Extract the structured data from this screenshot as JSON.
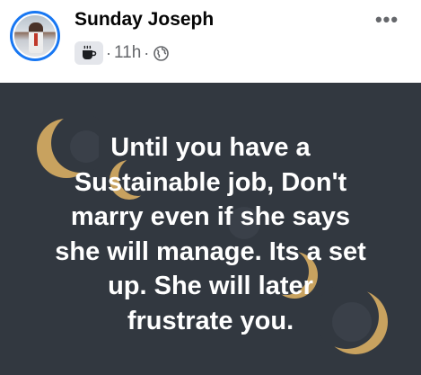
{
  "post": {
    "author": "Sunday Joseph",
    "time": "11h",
    "audience_icon": "globe-icon",
    "activity_icon": "coffee-cup-icon",
    "more_label": "•••",
    "text_lines": [
      "Until you have a",
      "Sustainable job, Don't",
      "marry even if she says",
      "she will manage. Its a set",
      "up. She will later",
      "frustrate you."
    ],
    "background_color": "#323840",
    "text_color": "#ffffff",
    "moon_color": "#c8a25f"
  }
}
